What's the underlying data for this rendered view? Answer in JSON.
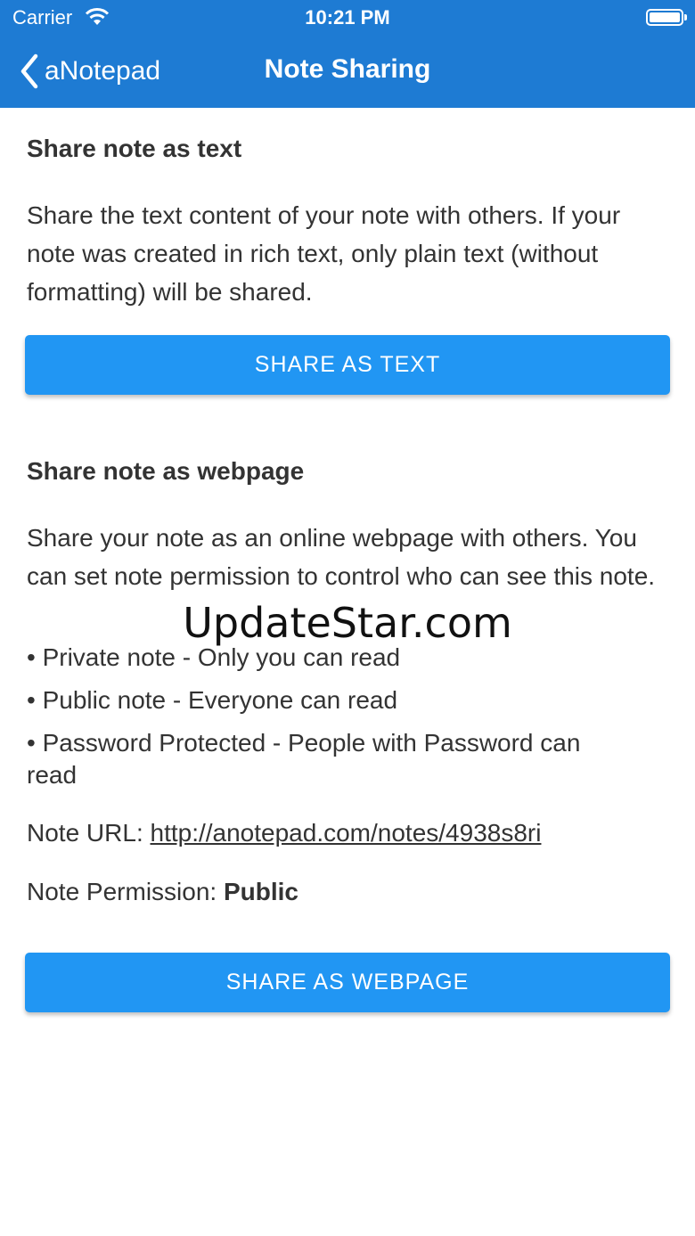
{
  "status_bar": {
    "carrier": "Carrier",
    "time": "10:21 PM",
    "icons": [
      "wifi-icon",
      "battery-icon"
    ]
  },
  "nav": {
    "back_label": "aNotepad",
    "title": "Note Sharing",
    "back_icon": "chevron-left-icon"
  },
  "colors": {
    "header_bg": "#1e7bd3",
    "button_bg": "#2196f3",
    "text": "#333333"
  },
  "text_section": {
    "heading": "Share note as text",
    "description": "Share the text content of your note with others. If your note was created in rich text, only plain text (without formatting) will be shared.",
    "button_label": "SHARE AS TEXT"
  },
  "webpage_section": {
    "heading": "Share note as webpage",
    "description": "Share your note as an online webpage with others. You can set note permission to control who can see this note.",
    "bullets": [
      "• Private note - Only you can read",
      "• Public note - Everyone can read",
      "• Password Protected - People with Password can read"
    ],
    "url_label": "Note URL: ",
    "url_value": "http://anotepad.com/notes/4938s8ri",
    "permission_label": "Note Permission: ",
    "permission_value": "Public",
    "button_label": "SHARE AS WEBPAGE"
  },
  "watermark": "UpdateStar.com"
}
